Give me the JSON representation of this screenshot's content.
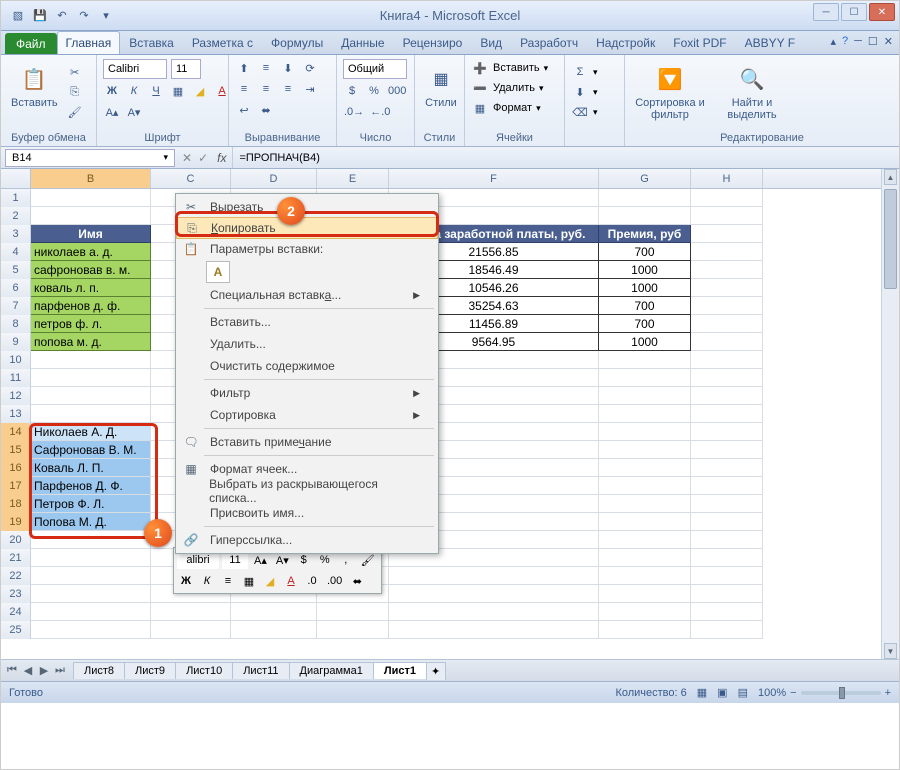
{
  "window": {
    "title": "Книга4 - Microsoft Excel"
  },
  "tabs": {
    "file": "Файл",
    "items": [
      "Главная",
      "Вставка",
      "Разметка с",
      "Формулы",
      "Данные",
      "Рецензиро",
      "Вид",
      "Разработч",
      "Надстройк",
      "Foxit PDF",
      "ABBYY F"
    ]
  },
  "ribbon": {
    "paste": "Вставить",
    "clipboard": "Буфер обмена",
    "font_name": "Calibri",
    "font_size": "11",
    "font": "Шрифт",
    "align": "Выравнивание",
    "number_fmt": "Общий",
    "number": "Число",
    "styles": "Стили",
    "styles_btn": "Стили",
    "insert": "Вставить",
    "delete": "Удалить",
    "format": "Формат",
    "cells": "Ячейки",
    "sort": "Сортировка и фильтр",
    "find": "Найти и выделить",
    "editing": "Редактирование"
  },
  "formula_bar": {
    "name": "B14",
    "value": "=ПРОПНАЧ(B4)"
  },
  "columns": [
    "B",
    "C",
    "D",
    "E",
    "F",
    "G",
    "H"
  ],
  "table": {
    "headers": {
      "name": "Имя",
      "sum": "Сумма заработной платы, руб.",
      "bonus": "Премия, руб"
    },
    "rows": [
      {
        "name": "николаев а. д.",
        "sum": "21556.85",
        "bonus": "700"
      },
      {
        "name": "сафроновав в. м.",
        "sum": "18546.49",
        "bonus": "1000"
      },
      {
        "name": "коваль л. п.",
        "sum": "10546.26",
        "bonus": "1000"
      },
      {
        "name": "парфенов д. ф.",
        "sum": "35254.63",
        "bonus": "700"
      },
      {
        "name": "петров ф. л.",
        "sum": "11456.89",
        "bonus": "700"
      },
      {
        "name": "попова м. д.",
        "sum": "9564.95",
        "bonus": "1000"
      }
    ]
  },
  "proper": [
    "Николаев А. Д.",
    "Сафроновав В. М.",
    "Коваль Л. П.",
    "Парфенов Д. Ф.",
    "Петров Ф. Л.",
    "Попова М. Д."
  ],
  "context_menu": {
    "cut": "Вырезать",
    "copy": "Копировать",
    "paste_opts": "Параметры вставки:",
    "paste_special": "Специальная вставка...",
    "insert": "Вставить...",
    "delete": "Удалить...",
    "clear": "Очистить содержимое",
    "filter": "Фильтр",
    "sort": "Сортировка",
    "comment": "Вставить примечание",
    "fmt": "Формат ячеек...",
    "dropdown": "Выбрать из раскрывающегося списка...",
    "name": "Присвоить имя...",
    "link": "Гиперссылка..."
  },
  "mini_toolbar": {
    "font": "alibri",
    "size": "11"
  },
  "sheets": [
    "Лист8",
    "Лист9",
    "Лист10",
    "Лист11",
    "Диаграмма1",
    "Лист1"
  ],
  "status": {
    "ready": "Готово",
    "count": "Количество: 6",
    "zoom": "100%"
  },
  "callouts": {
    "one": "1",
    "two": "2"
  }
}
